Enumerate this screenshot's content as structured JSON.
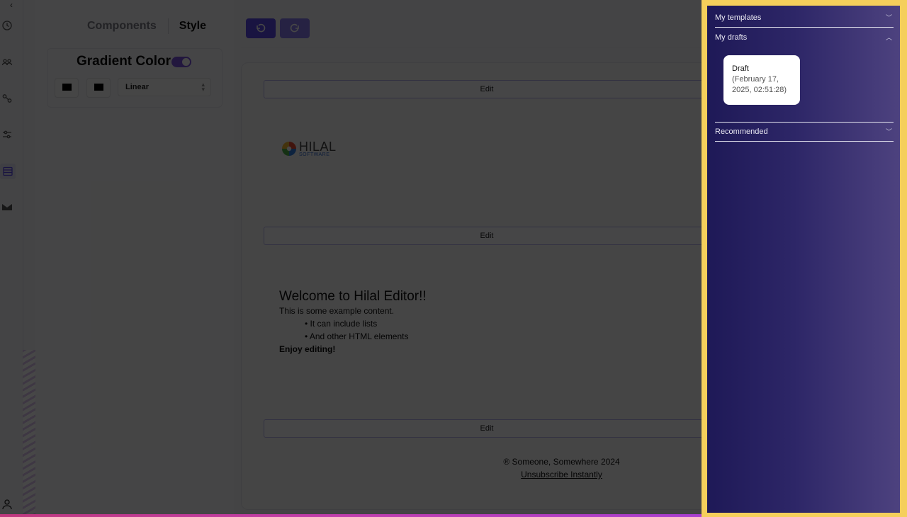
{
  "rail": {
    "collapse_glyph": "‹",
    "icons": [
      "history-icon",
      "users-icon",
      "connection-icon",
      "sliders-icon",
      "template-icon",
      "mail-icon",
      "user-icon"
    ]
  },
  "panel": {
    "tabs": [
      {
        "label": "Components",
        "active": false
      },
      {
        "label": "Style",
        "active": true
      }
    ],
    "gradient_title": "Gradient Color",
    "gradient_enabled": true,
    "color1": "#000000",
    "color2": "#000000",
    "gradient_type": "Linear"
  },
  "toolbar": {
    "undo_icon": "undo-icon",
    "redo_icon": "redo-icon"
  },
  "canvas": {
    "edit_label": "Edit",
    "logo": {
      "name": "HILAL",
      "tagline": "SOFTWARE"
    },
    "content": {
      "heading": "Welcome to Hilal Editor!!",
      "intro": "This is some example content.",
      "list": [
        "It can include lists",
        "And other HTML elements"
      ],
      "closing": "Enjoy editing!"
    },
    "footer": {
      "copyright": "® Someone, Somewhere 2024",
      "unsubscribe": "Unsubscribe Instantly"
    }
  },
  "sidebar": {
    "sections": [
      {
        "label": "My templates",
        "expanded": false
      },
      {
        "label": "My drafts",
        "expanded": true
      },
      {
        "label": "Recommended",
        "expanded": false
      }
    ],
    "draft": {
      "title": "Draft",
      "date": "(February 17, 2025, 02:51:28)"
    }
  },
  "colors": {
    "accent": "#5a49e8",
    "highlight_border": "#f5cf5b",
    "sidebar_gradient_start": "#1e1957",
    "sidebar_gradient_end": "#4d427f"
  }
}
